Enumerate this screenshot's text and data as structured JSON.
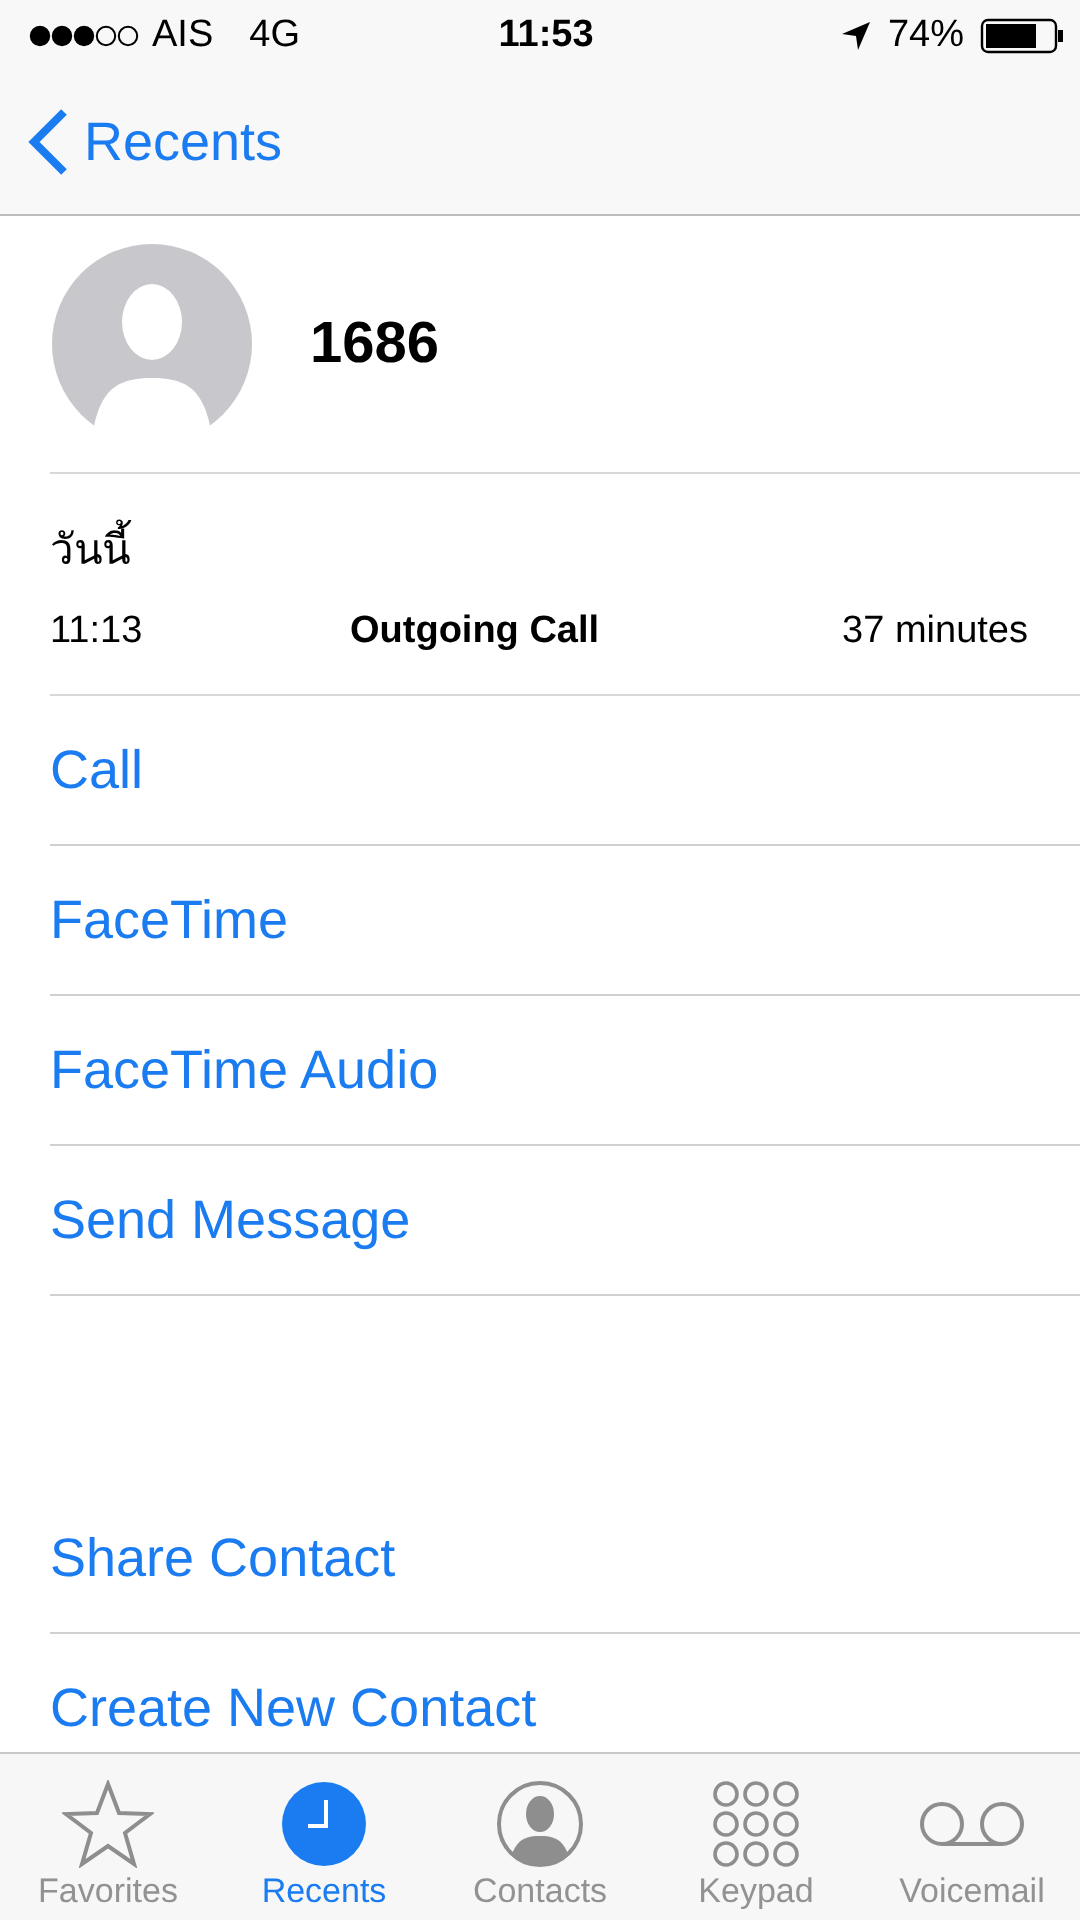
{
  "status_bar": {
    "carrier": "AIS",
    "network": "4G",
    "time": "11:53",
    "battery": "74%"
  },
  "nav": {
    "back": "Recents"
  },
  "contact": {
    "name": "1686"
  },
  "call_log": {
    "date": "วันนี้",
    "time": "11:13",
    "type": "Outgoing Call",
    "duration": "37 minutes"
  },
  "actions": [
    "Call",
    "FaceTime",
    "FaceTime Audio",
    "Send Message"
  ],
  "more_actions": [
    "Share Contact",
    "Create New Contact"
  ],
  "tabs": [
    {
      "label": "Favorites",
      "kind": "star",
      "selected": false
    },
    {
      "label": "Recents",
      "kind": "clock",
      "selected": true
    },
    {
      "label": "Contacts",
      "kind": "person",
      "selected": false
    },
    {
      "label": "Keypad",
      "kind": "keypad",
      "selected": false
    },
    {
      "label": "Voicemail",
      "kind": "voicemail",
      "selected": false
    }
  ]
}
